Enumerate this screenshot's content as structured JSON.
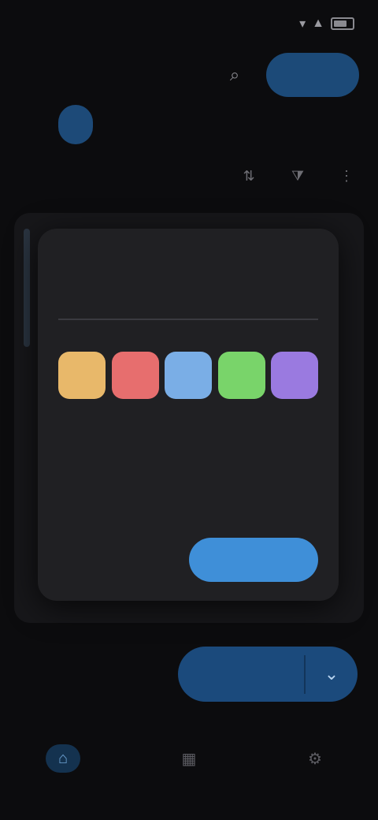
{
  "status": {
    "time": "",
    "icons": [
      "wifi-icon",
      "signal-icon",
      "battery-icon"
    ]
  },
  "header": {
    "title": "",
    "icon": "search-icon",
    "button_label": ""
  },
  "tabs": [
    {
      "label": "",
      "active": false
    },
    {
      "label": "",
      "active": true
    },
    {
      "label": "",
      "active": false
    },
    {
      "label": "",
      "active": false
    }
  ],
  "toolbar": {
    "label": "",
    "icons": [
      "sort-icon",
      "filter-icon",
      "more-icon"
    ]
  },
  "dialog": {
    "title": "",
    "name_label": "",
    "name_value": "",
    "name_placeholder": "",
    "color_label": "",
    "colors": [
      "#e8b86a",
      "#e76e6e",
      "#7aaee6",
      "#79d46a",
      "#9a7ae0"
    ],
    "cancel_label": "",
    "confirm_label": ""
  },
  "fab": {
    "label": "",
    "icon": "chevron-down-icon"
  },
  "bottomnav": [
    {
      "label": "",
      "icon": "home-icon",
      "active": true
    },
    {
      "label": "",
      "icon": "grid-icon",
      "active": false
    },
    {
      "label": "",
      "icon": "settings-icon",
      "active": false
    }
  ],
  "colors": {
    "accent": "#3f8fd8",
    "accent_dark": "#1b4a7c",
    "surface": "#202023",
    "background": "#0c0c0e"
  }
}
